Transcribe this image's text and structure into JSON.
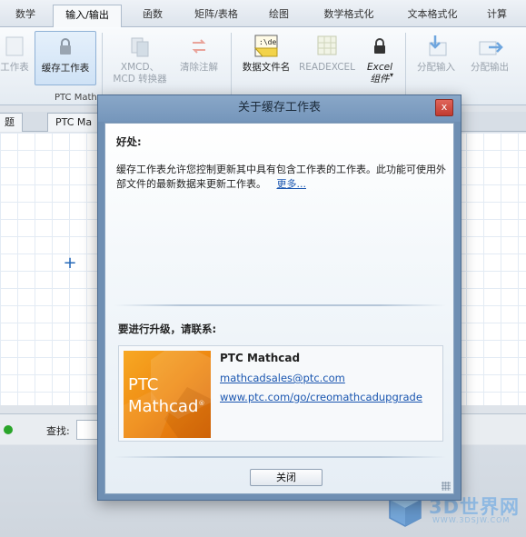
{
  "ribbon": {
    "tabs": [
      {
        "label": "数学"
      },
      {
        "label": "输入/输出"
      },
      {
        "label": "函数"
      },
      {
        "label": "矩阵/表格"
      },
      {
        "label": "绘图"
      },
      {
        "label": "数学格式化"
      },
      {
        "label": "文本格式化"
      },
      {
        "label": "计算"
      }
    ],
    "active_tab": "输入/输出",
    "buttons": {
      "worksheet_partial": "工作表",
      "cache_worksheet": "缓存工作表",
      "xmcd_line1": "XMCD、",
      "xmcd_line2": "MCD 转换器",
      "clear_annotation": "清除注解",
      "data_filename": "数据文件名",
      "readexcel": "READEXCEL",
      "excel_component_line1": "Excel",
      "excel_component_line2": "组件",
      "assign_input": "分配输入",
      "assign_output": "分配输出"
    },
    "group_label": "PTC Mathc",
    "data_icon_text": ":\\de"
  },
  "doc_tabs": [
    "题",
    "PTC Ma"
  ],
  "statusbar": {
    "find_label": "查找:"
  },
  "dialog": {
    "title": "关于缓存工作表",
    "close_symbol": "x",
    "benefit_heading": "好处:",
    "benefit_text": "缓存工作表允许您控制更新其中具有包含工作表的工作表。此功能可使用外部文件的最新数据来更新工作表。",
    "more_link": "更多...",
    "upgrade_heading": "要进行升级，请联系:",
    "contact": {
      "name": "PTC Mathcad",
      "email": "mathcadsales@ptc.com",
      "url": "www.ptc.com/go/creomathcadupgrade"
    },
    "logo_line1": "PTC",
    "logo_line2": "Mathcad",
    "logo_mark": "®",
    "close_button": "关闭"
  },
  "watermark": {
    "text": "3D世界网",
    "sub": "WWW.3DSJW.COM"
  }
}
